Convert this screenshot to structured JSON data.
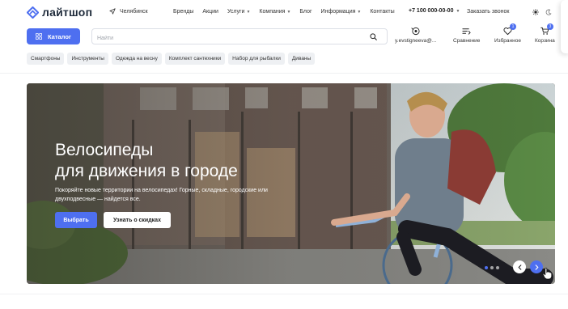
{
  "header": {
    "logo_text": "лайтшоп",
    "city": "Челябинск",
    "nav": [
      {
        "label": "Бренды",
        "dropdown": false
      },
      {
        "label": "Акции",
        "dropdown": false
      },
      {
        "label": "Услуги",
        "dropdown": true
      },
      {
        "label": "Компания",
        "dropdown": true
      },
      {
        "label": "Блог",
        "dropdown": false
      },
      {
        "label": "Информация",
        "dropdown": true
      },
      {
        "label": "Контакты",
        "dropdown": false
      }
    ],
    "phone": "+7 100 000-00-00",
    "callback": "Заказать звонок"
  },
  "toolbar": {
    "catalog_label": "Каталог",
    "search_placeholder": "Найти",
    "account_label": "y.evstigneeva@...",
    "compare_label": "Сравнение",
    "favorites_label": "Избранное",
    "favorites_count": "1",
    "cart_label": "Корзина",
    "cart_count": "3"
  },
  "chips": [
    "Смартфоны",
    "Инструменты",
    "Одежда на весну",
    "Комплект сантехники",
    "Набор для рыбалки",
    "Диваны"
  ],
  "banner": {
    "title_line1": "Велосипеды",
    "title_line2": "для движения в городе",
    "text": "Покоряйте новые территории на велосипедах! Горные, складные, городские или двухподвесные — найдется все.",
    "primary_button": "Выбрать",
    "secondary_button": "Узнать о скидках",
    "slides_total": 3,
    "active_slide": 1
  },
  "colors": {
    "accent": "#4e6ff0",
    "chip_bg": "#eef0f3",
    "text": "#1f1f1f"
  },
  "icons": [
    "logo-mark-icon",
    "location-arrow-icon",
    "sun-icon",
    "moon-icon",
    "catalog-grid-icon",
    "search-icon",
    "user-icon",
    "compare-icon",
    "heart-icon",
    "cart-icon",
    "chevron-left-icon",
    "chevron-right-icon",
    "pointer-hand-icon"
  ]
}
